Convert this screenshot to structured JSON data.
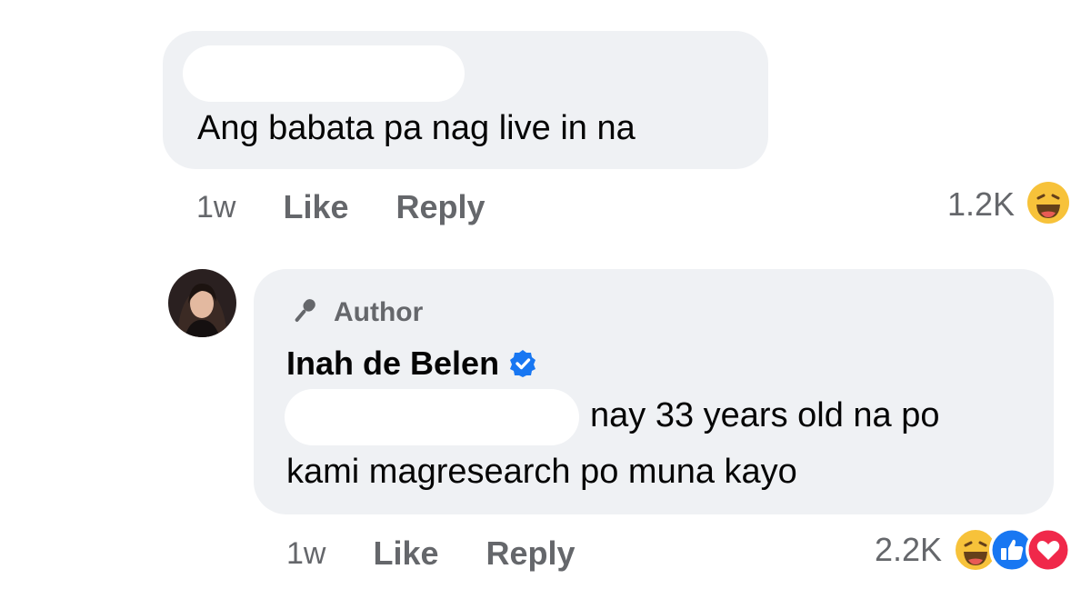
{
  "comments": [
    {
      "text": "Ang babata pa nag live in na",
      "time": "1w",
      "like_label": "Like",
      "reply_label": "Reply",
      "reaction_count": "1.2K",
      "reactions": [
        "haha-icon"
      ]
    },
    {
      "author_badge": "Author",
      "author_name": "Inah de Belen",
      "verified": true,
      "text_line_1": "nay 33 years old na po",
      "text_line_2": "kami magresearch po muna kayo",
      "time": "1w",
      "like_label": "Like",
      "reply_label": "Reply",
      "reaction_count": "2.2K",
      "reactions": [
        "haha-icon",
        "like-icon",
        "love-icon"
      ]
    }
  ],
  "colors": {
    "bubble": "#eff1f4",
    "meta_text": "#65676b",
    "verified_blue": "#1877f2",
    "like_blue": "#1877f2",
    "love_red": "#f0284a",
    "haha_yellow": "#f7c23a"
  }
}
